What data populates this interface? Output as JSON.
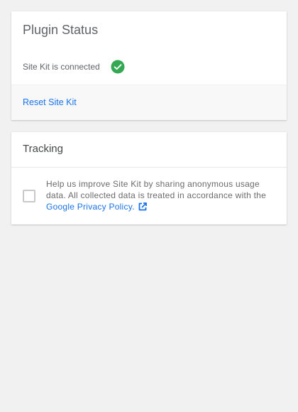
{
  "plugin_status": {
    "title": "Plugin Status",
    "status_text": "Site Kit is connected",
    "status_icon": "check-circle-icon",
    "status_color": "#34a853",
    "reset_label": "Reset Site Kit"
  },
  "tracking": {
    "title": "Tracking",
    "checkbox_checked": false,
    "description": "Help us improve Site Kit by sharing anonymous usage data. All collected data is treated in accordance with the",
    "link_label": "Google Privacy Policy.",
    "link_icon": "external-link-icon"
  },
  "colors": {
    "page_background": "#f1f1f1",
    "card_background": "#ffffff",
    "link": "#1a73e8",
    "text": "#5f6368"
  }
}
